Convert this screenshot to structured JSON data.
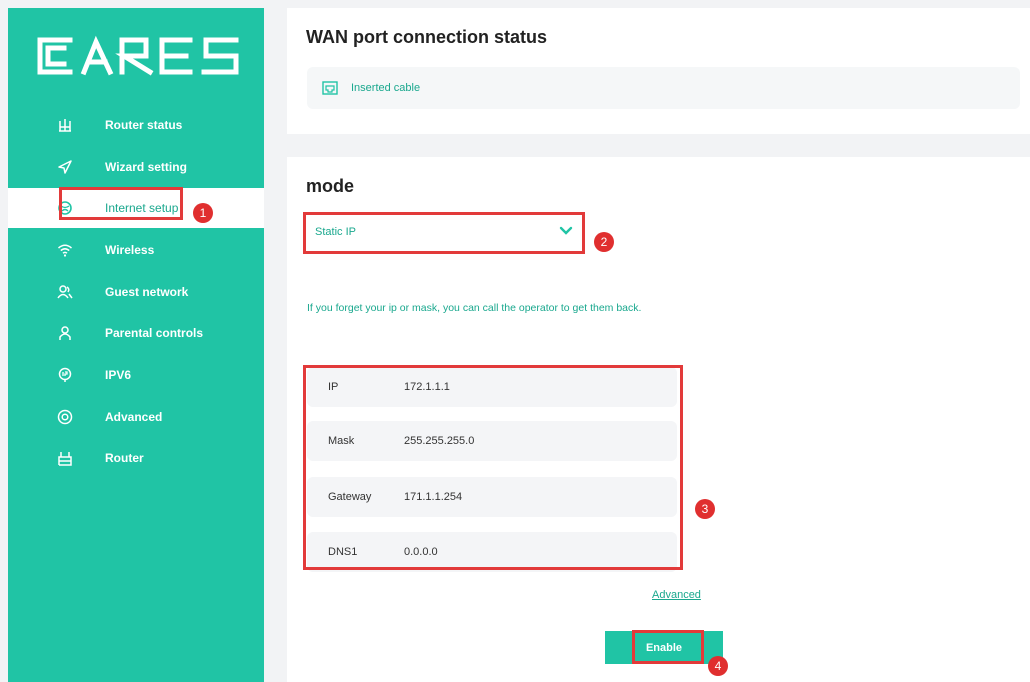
{
  "sidebar": {
    "logo_text": "CARES",
    "items": [
      {
        "label": "Router status",
        "icon": "router-status-icon"
      },
      {
        "label": "Wizard setting",
        "icon": "send-icon"
      },
      {
        "label": "Internet setup",
        "icon": "globe-icon",
        "active": true
      },
      {
        "label": "Wireless",
        "icon": "wifi-icon"
      },
      {
        "label": "Guest network",
        "icon": "users-icon"
      },
      {
        "label": "Parental controls",
        "icon": "person-icon"
      },
      {
        "label": "IPV6",
        "icon": "ipv6-icon"
      },
      {
        "label": "Advanced",
        "icon": "advanced-icon"
      },
      {
        "label": "Router",
        "icon": "router-icon"
      }
    ]
  },
  "wan": {
    "title": "WAN port connection status",
    "status": "Inserted cable"
  },
  "mode": {
    "title": "mode",
    "selected": "Static IP",
    "hint": "If you forget your ip or mask, you can call the operator to get them back.",
    "fields": [
      {
        "label": "IP",
        "value": "172.1.1.1"
      },
      {
        "label": "Mask",
        "value": "255.255.255.0"
      },
      {
        "label": "Gateway",
        "value": "171.1.1.254"
      },
      {
        "label": "DNS1",
        "value": "0.0.0.0"
      }
    ],
    "advanced_link": "Advanced",
    "enable_label": "Enable"
  },
  "annotations": [
    "1",
    "2",
    "3",
    "4"
  ],
  "colors": {
    "accent": "#20c4a5",
    "highlight": "#e23a3a"
  }
}
